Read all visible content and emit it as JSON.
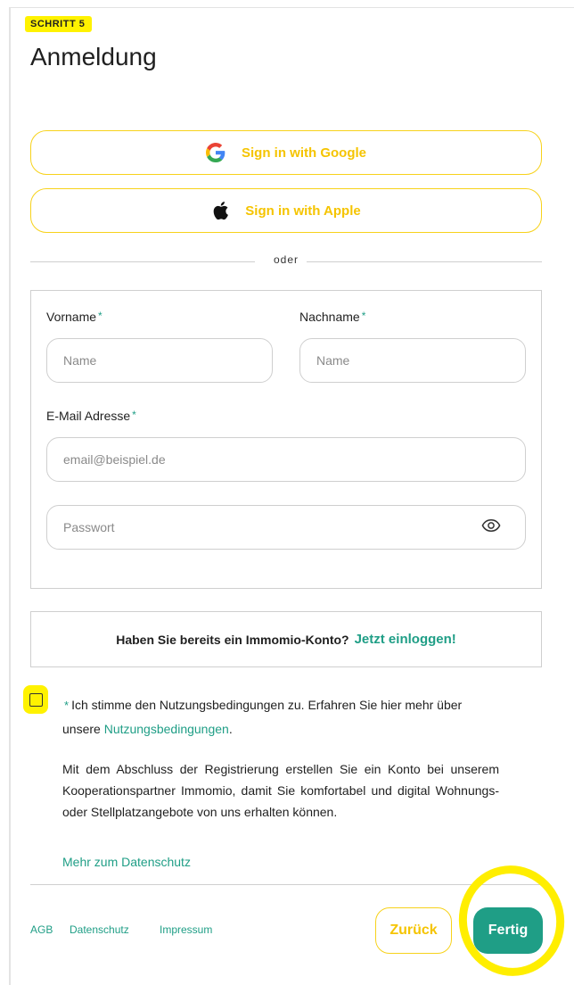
{
  "header": {
    "step": "SCHRITT 5",
    "title": "Anmeldung"
  },
  "sso": {
    "google_label": "Sign in with Google",
    "apple_label": "Sign in with Apple"
  },
  "divider_text": "oder",
  "form": {
    "firstname_label": "Vorname",
    "firstname_placeholder": "Name",
    "lastname_label": "Nachname",
    "lastname_placeholder": "Name",
    "email_label": "E-Mail Adresse",
    "email_placeholder": "email@beispiel.de",
    "password_placeholder": "Passwort",
    "required_mark": "*"
  },
  "login_prompt": {
    "text": "Haben Sie bereits ein Immomio-Konto?",
    "link": "Jetzt einloggen!"
  },
  "terms": {
    "text": "Ich stimme den Nutzungsbedingungen zu. Erfahren Sie hier mehr über unsere",
    "link": "Nutzungsbedingungen",
    "suffix": "."
  },
  "info": {
    "text": "Mit dem Abschluss der Registrierung erstellen Sie ein Konto bei unserem Kooperationspartner Immomio, damit Sie komfortabel und digital Wohnungs- oder Stellplatzangebote von uns erhalten können.",
    "privacy_link": "Mehr zum Datenschutz"
  },
  "footer": {
    "links": [
      "AGB",
      "Datenschutz",
      "Impressum"
    ],
    "back_label": "Zurück",
    "finish_label": "Fertig"
  },
  "colors": {
    "accent": "#1f9e86",
    "secondary": "#f5c400",
    "highlight": "#fff200"
  },
  "icons": {
    "google": "google-logo-icon",
    "apple": "apple-logo-icon",
    "eye": "eye-icon"
  }
}
